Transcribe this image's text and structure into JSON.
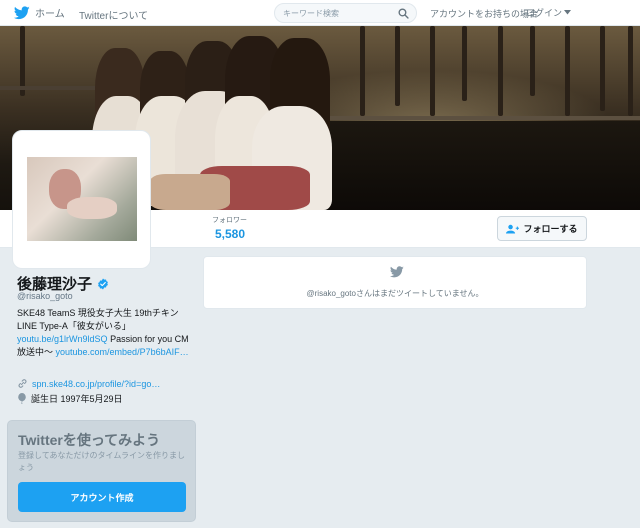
{
  "nav": {
    "home_label": "ホーム",
    "about_label": "Twitterについて",
    "search_placeholder": "キーワード検索",
    "account_prompt": "アカウントをお持ちの場合",
    "login_label": "ログイン"
  },
  "stats": {
    "followers_label": "フォロワー",
    "followers_value": "5,580"
  },
  "follow_button_label": "フォローする",
  "profile": {
    "name": "後藤理沙子",
    "handle": "@risako_goto",
    "bio_text": "SKE48 TeamS 現役女子大生 19thチキンLINE Type-A「彼女がいる」",
    "bio_link1": "youtu.be/g1lrWn9ldSQ",
    "bio_text2": " Passion for you CM放送中〜 ",
    "bio_link2": "youtube.com/embed/P7b6bAIF…",
    "website": "spn.ske48.co.jp/profile/?id=go…",
    "birthday": "誕生日 1997年5月29日"
  },
  "signup": {
    "title": "Twitterを使ってみよう",
    "description": "登録してあなただけのタイムラインを作りましょう",
    "button_label": "アカウント作成"
  },
  "timeline": {
    "empty_text": "@risako_gotoさんはまだツイートしていません。"
  },
  "colors": {
    "accent": "#1da1f2",
    "link": "#1b95e0",
    "background": "#e6ecf0"
  },
  "icons": {
    "nav": "twitter-bird-icon",
    "search": "search-icon",
    "follow": "add-user-icon",
    "verified": "verified-badge-icon",
    "link": "link-icon",
    "birthday": "balloon-icon",
    "timeline": "twitter-bird-icon"
  }
}
